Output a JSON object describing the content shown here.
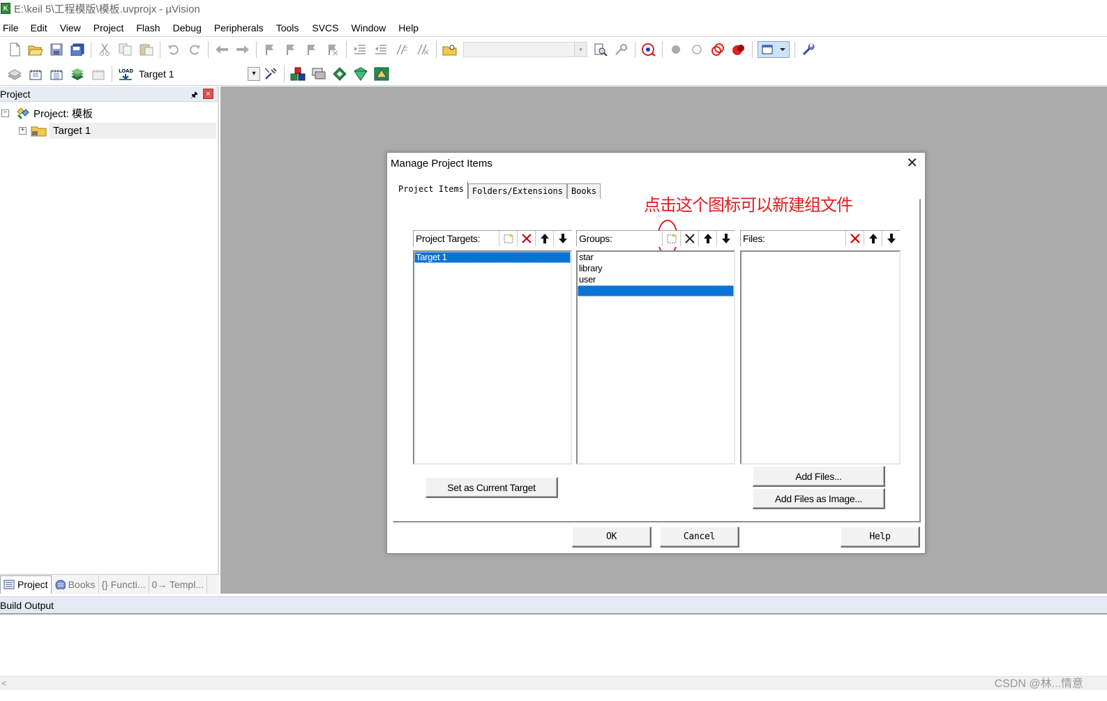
{
  "window": {
    "title": "E:\\keil 5\\工程模版\\模板.uvprojx - µVision",
    "app_icon": "keil-app-icon"
  },
  "menu": [
    "File",
    "Edit",
    "View",
    "Project",
    "Flash",
    "Debug",
    "Peripherals",
    "Tools",
    "SVCS",
    "Window",
    "Help"
  ],
  "toolbar2": {
    "target_label": "Target 1"
  },
  "project_panel": {
    "title": "Project",
    "tree": {
      "root": "Project: 模板",
      "child": "Target 1"
    },
    "tabs": [
      "Project",
      "Books",
      "{} Functi...",
      "0→ Templ..."
    ]
  },
  "build_output": {
    "title": "Build Output"
  },
  "watermark": "CSDN @林...情意",
  "dialog": {
    "title": "Manage Project Items",
    "tabs": [
      "Project Items",
      "Folders/Extensions",
      "Books"
    ],
    "annotation": "点击这个图标可以新建组文件",
    "annotation_color": "#e11d1d",
    "targets_label": "Project Targets:",
    "targets": [
      "Target 1"
    ],
    "groups_label": "Groups:",
    "groups": [
      "star",
      "library",
      "user",
      ""
    ],
    "files_label": "Files:",
    "set_current_target": "Set as Current Target",
    "add_files": "Add Files...",
    "add_files_image": "Add Files as Image...",
    "ok": "OK",
    "cancel": "Cancel",
    "help": "Help",
    "selection_color": "#0a73d6"
  }
}
